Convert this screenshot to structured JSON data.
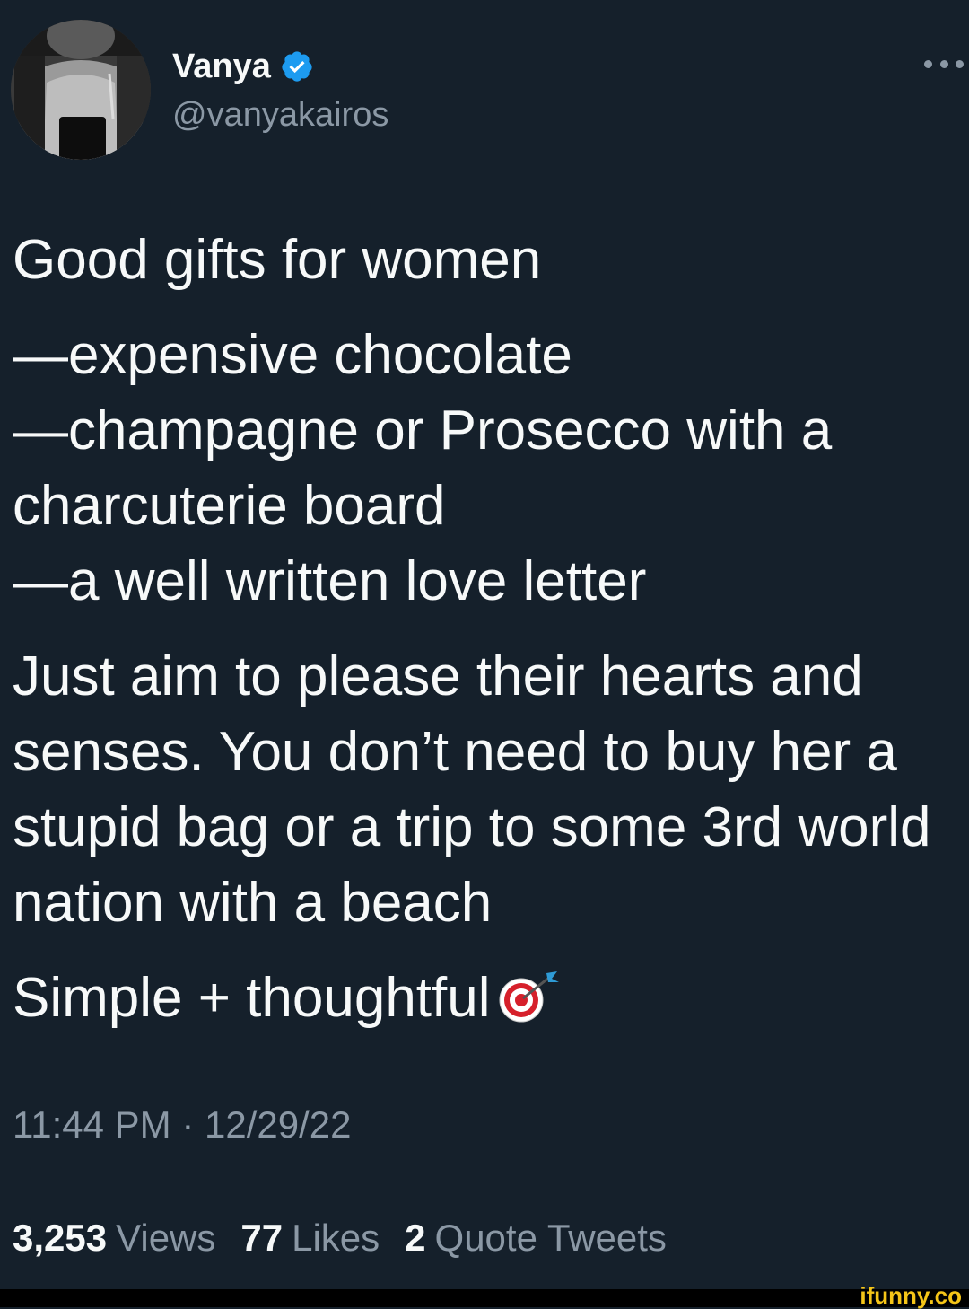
{
  "author": {
    "display_name": "Vanya",
    "handle": "@vanyakairos",
    "verified": true
  },
  "tweet": {
    "headline": "Good gifts for women",
    "list_items": [
      "—expensive chocolate",
      "—champagne or Prosecco with a charcuterie board",
      "—a well written love letter"
    ],
    "paragraph": "Just aim to please their hearts and senses. You don’t need to buy her a stupid bag or a trip to some 3rd world nation with a beach",
    "closing": "Simple + thoughtful",
    "closing_icon": "direct-hit-target-icon",
    "timestamp": "11:44 PM · 12/29/22"
  },
  "stats": {
    "views_count": "3,253",
    "views_label": "Views",
    "likes_count": "77",
    "likes_label": "Likes",
    "quotes_count": "2",
    "quotes_label": "Quote Tweets"
  },
  "watermark": "ifunny.co",
  "colors": {
    "background": "#15202b",
    "text_primary": "#f7f9f9",
    "text_secondary": "#8b98a5",
    "verified_blue": "#1d9bf0",
    "divider": "#38444d"
  }
}
